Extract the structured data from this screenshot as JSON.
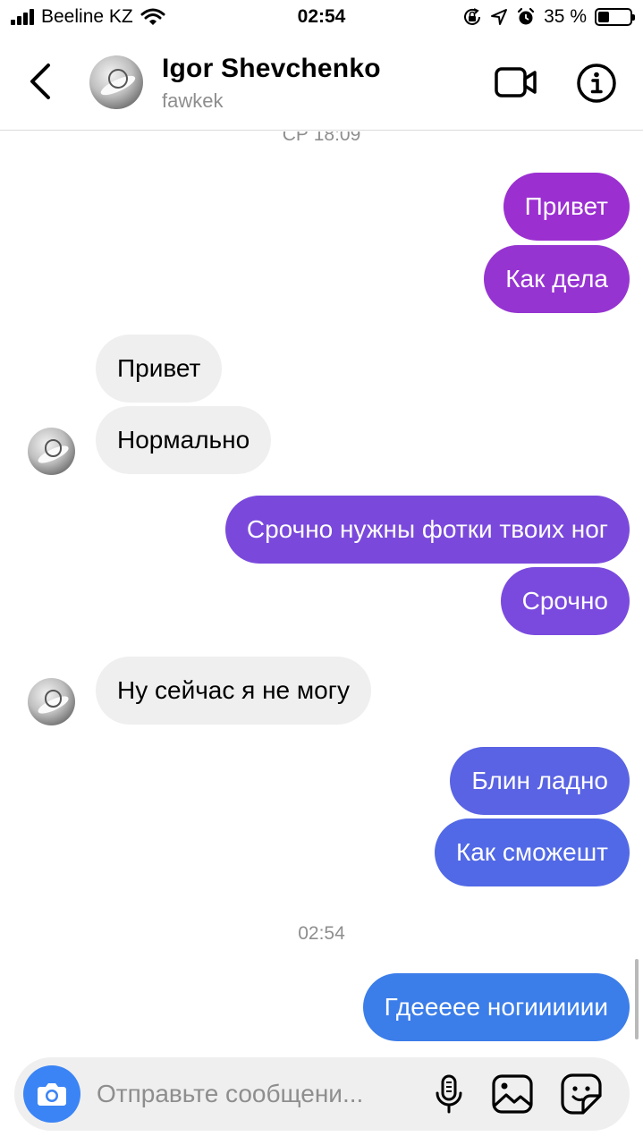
{
  "status_bar": {
    "carrier": "Beeline KZ",
    "time": "02:54",
    "battery": "35 %",
    "battery_level": 0.35,
    "icons": [
      "signal-bars-icon",
      "wifi-icon",
      "orientation-lock-icon",
      "location-icon",
      "alarm-icon",
      "battery-icon"
    ]
  },
  "header": {
    "name": "Igor Shevchenko",
    "username": "fawkek",
    "icons": [
      "back-chevron-icon",
      "video-camera-icon",
      "info-icon"
    ]
  },
  "chat": {
    "timestamps": [
      "СР 18:09",
      "02:54"
    ],
    "messages": [
      {
        "from": "me",
        "text": "Привет",
        "color": "#9b2fd0"
      },
      {
        "from": "me",
        "text": "Как дела",
        "color": "#9634d1"
      },
      {
        "from": "them",
        "text": "Привет"
      },
      {
        "from": "them",
        "text": "Нормально"
      },
      {
        "from": "me",
        "text": "Срочно нужны фотки твоих ног",
        "color": "#7a49dc"
      },
      {
        "from": "me",
        "text": "Срочно",
        "color": "#7a4ade"
      },
      {
        "from": "them",
        "text": "Ну сейчас я не могу"
      },
      {
        "from": "me",
        "text": "Блин ладно",
        "color": "#5a63e3"
      },
      {
        "from": "me",
        "text": "Как сможешт",
        "color": "#5169e6"
      },
      {
        "from": "me",
        "text": "Гдеееее ногииииии",
        "color": "#3b7de9"
      }
    ]
  },
  "composer": {
    "placeholder": "Отправьте сообщени...",
    "icons": [
      "camera-icon",
      "microphone-icon",
      "gallery-icon",
      "sticker-icon"
    ]
  },
  "colors": {
    "accent_blue": "#3a84f5",
    "incoming_bubble": "#efefef",
    "secondary_text": "#8e8e8e"
  }
}
